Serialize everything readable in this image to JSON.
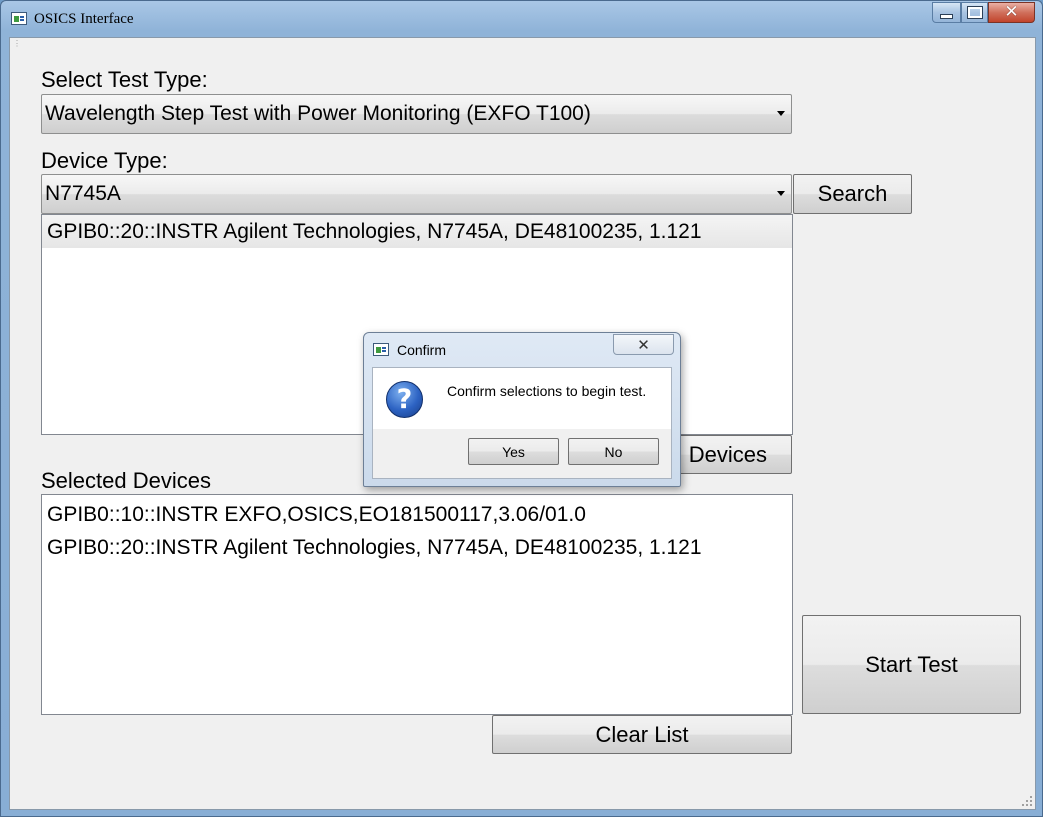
{
  "window": {
    "title": "OSICS Interface",
    "controls": {
      "minimize_icon": "minimize-icon",
      "maximize_icon": "maximize-icon",
      "close_icon": "close-icon"
    }
  },
  "test_type": {
    "label": "Select Test Type:",
    "selected": "Wavelength Step Test with Power Monitoring (EXFO T100)"
  },
  "device_type": {
    "label": "Device Type:",
    "selected": "N7745A",
    "search_button": "Search"
  },
  "found_devices": [
    "GPIB0::20::INSTR Agilent Technologies, N7745A, DE48100235, 1.121"
  ],
  "add_devices_button": "Devices",
  "selected_devices": {
    "label": "Selected Devices",
    "items": [
      "GPIB0::10::INSTR EXFO,OSICS,EO181500117,3.06/01.0",
      "GPIB0::20::INSTR Agilent Technologies, N7745A, DE48100235, 1.121"
    ]
  },
  "clear_list_button": "Clear List",
  "start_test_button": "Start Test",
  "dialog": {
    "title": "Confirm",
    "message": "Confirm selections to begin test.",
    "icon": "question-icon",
    "yes_button": "Yes",
    "no_button": "No",
    "close_glyph": "✕"
  }
}
